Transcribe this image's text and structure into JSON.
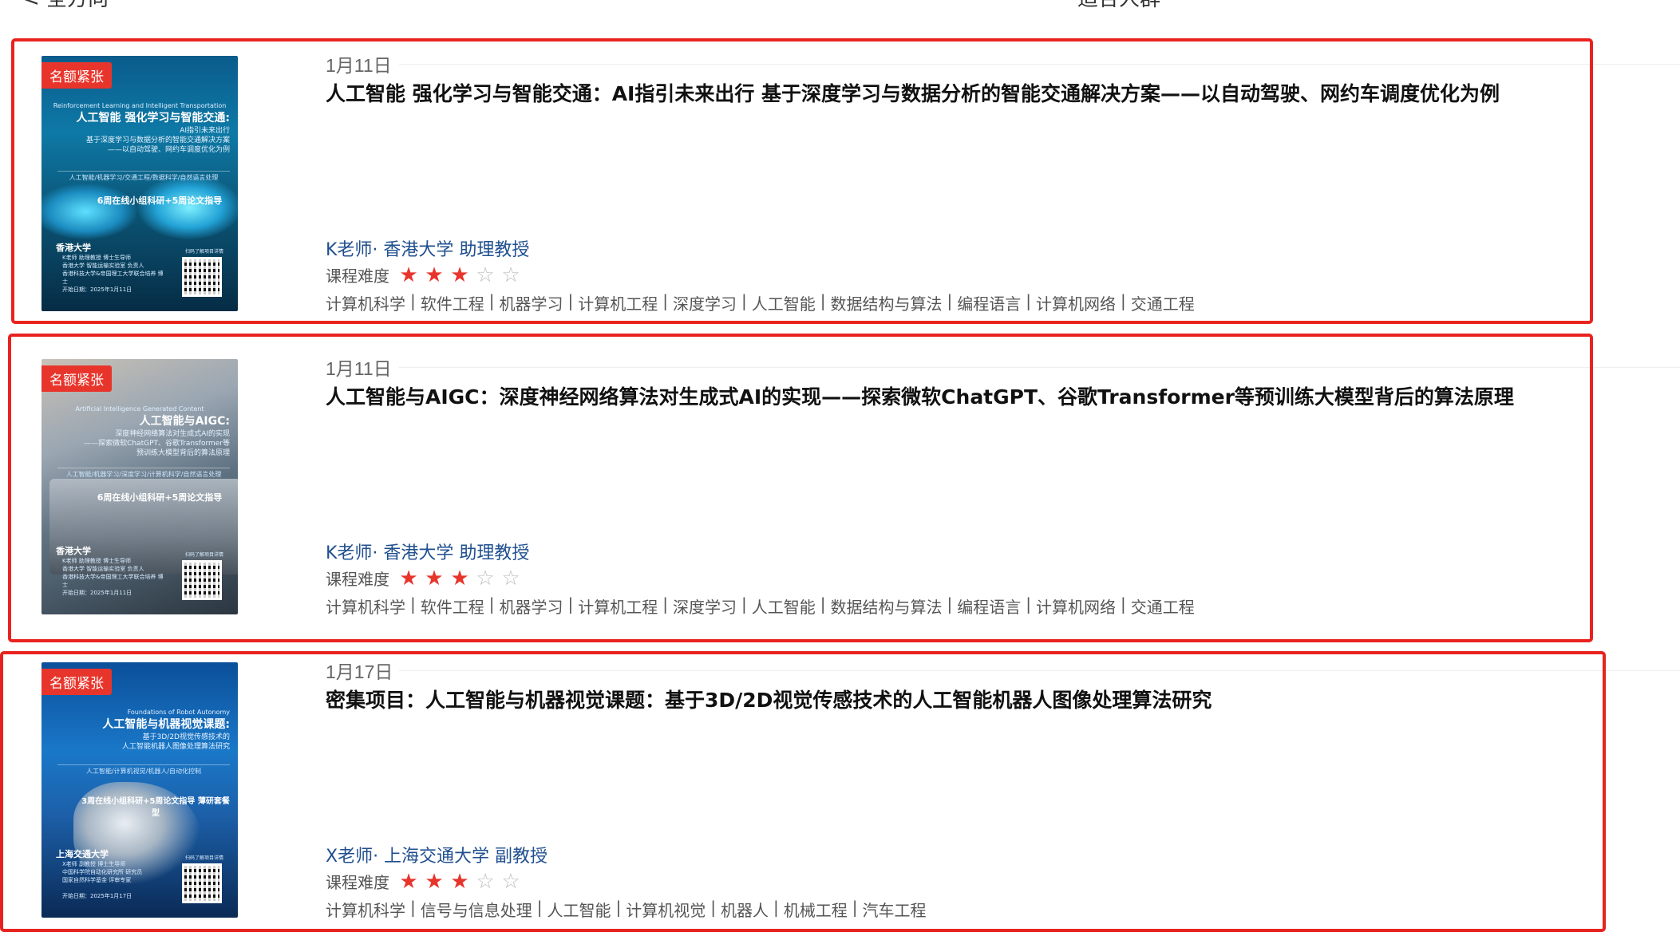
{
  "header": {
    "left_text": "< 全方向",
    "right_text": "适合人群"
  },
  "difficulty_label": "课程难度",
  "badge_label": "名额紧张",
  "colors": {
    "accent_red": "#e8231f",
    "teacher_blue": "#1f4f8f",
    "star_on": "#e8352c",
    "star_off": "#bdbdbd"
  },
  "courses": [
    {
      "date": "1月11日",
      "title": "人工智能 强化学习与智能交通：AI指引未来出行 基于深度学习与数据分析的智能交通解决方案——以自动驾驶、网约车调度优化为例",
      "teacher": "K老师· 香港大学 助理教授",
      "rating": 3,
      "rating_max": 5,
      "tags": [
        "计算机科学",
        "软件工程",
        "机器学习",
        "计算机工程",
        "深度学习",
        "人工智能",
        "数据结构与算法",
        "编程语言",
        "计算机网络",
        "交通工程"
      ],
      "cover": {
        "en_title": "Reinforcement Learning and Intelligent Transportation",
        "title": "人工智能 强化学习与智能交通:",
        "subtitle_lines": [
          "AI指引未来出行",
          "基于深度学习与数据分析的智能交通解决方案",
          "——以自动驾驶、网约车调度优化为例"
        ],
        "tags_line": "人工智能/机器学习/交通工程/数据科学/自然语言处理",
        "promo": "6周在线小组科研+5周论文指导",
        "university": "香港大学",
        "teacher_lines": [
          "K老师  助理教授 博士生导师",
          "香港大学 智能运输实验室 负责人",
          "香港科技大学&帝国理工大学联合培养 博士"
        ],
        "start_date": "开始日期：2025年1月11日",
        "qr_caption": "扫码了解项目详情",
        "icon": "car-illustration"
      }
    },
    {
      "date": "1月11日",
      "title": "人工智能与AIGC：深度神经网络算法对生成式AI的实现——探索微软ChatGPT、谷歌Transformer等预训练大模型背后的算法原理",
      "teacher": "K老师· 香港大学 助理教授",
      "rating": 3,
      "rating_max": 5,
      "tags": [
        "计算机科学",
        "软件工程",
        "机器学习",
        "计算机工程",
        "深度学习",
        "人工智能",
        "数据结构与算法",
        "编程语言",
        "计算机网络",
        "交通工程"
      ],
      "cover": {
        "en_title": "Artificial Intelligence Generated Content",
        "title": "人工智能与AIGC:",
        "subtitle_lines": [
          "深度神经网络算法对生成式AI的实现",
          "——探索微软ChatGPT、谷歌Transformer等",
          "预训练大模型背后的算法原理"
        ],
        "tags_line": "人工智能/机器学习/深度学习/计算机科学/自然语言处理",
        "promo": "6周在线小组科研+5周论文指导",
        "university": "香港大学",
        "teacher_lines": [
          "K老师  助理教授 博士生导师",
          "香港大学 智能运输实验室 负责人",
          "香港科技大学&帝国理工大学联合培养 博士"
        ],
        "start_date": "开始日期：2025年1月11日",
        "qr_caption": "扫码了解项目详情",
        "icon": "laptop-illustration"
      }
    },
    {
      "date": "1月17日",
      "title": "密集项目：人工智能与机器视觉课题：基于3D/2D视觉传感技术的人工智能机器人图像处理算法研究",
      "teacher": "X老师· 上海交通大学 副教授",
      "rating": 3,
      "rating_max": 5,
      "tags": [
        "计算机科学",
        "信号与信息处理",
        "人工智能",
        "计算机视觉",
        "机器人",
        "机械工程",
        "汽车工程"
      ],
      "cover": {
        "en_title": "Foundations of Robot Autonomy",
        "title": "人工智能与机器视觉课题:",
        "subtitle_lines": [
          "基于3D/2D视觉传感技术的",
          "人工智能机器人图像处理算法研究"
        ],
        "tags_line": "人工智能/计算机视觉/机器人/自动化控制",
        "promo": "3周在线小组科研+5周论文指导 薄研套餐型",
        "university": "上海交通大学",
        "teacher_lines": [
          "X老师  副教授 博士生导师",
          "中国科学院自动化研究所 研究员",
          "国家自然科学基金 评审专家"
        ],
        "start_date": "开始日期：2025年1月17日",
        "qr_caption": "扫码了解项目详情",
        "icon": "robot-arm-illustration"
      }
    }
  ]
}
